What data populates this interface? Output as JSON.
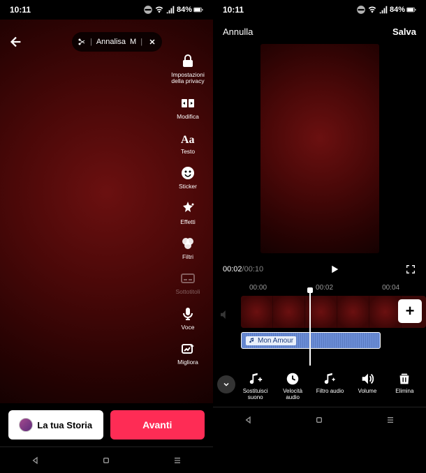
{
  "status": {
    "time": "10:11",
    "battery": "84%"
  },
  "left": {
    "music_pill": {
      "artist": "Annalisa",
      "track_partial": "M",
      "scissor": "scissor-icon"
    },
    "tools": [
      {
        "id": "privacy",
        "label": "Impostazioni della privacy",
        "icon": "lock"
      },
      {
        "id": "modifica",
        "label": "Modifica",
        "icon": "edit"
      },
      {
        "id": "testo",
        "label": "Testo",
        "icon": "text"
      },
      {
        "id": "sticker",
        "label": "Sticker",
        "icon": "sticker"
      },
      {
        "id": "effetti",
        "label": "Effetti",
        "icon": "effects"
      },
      {
        "id": "filtri",
        "label": "Filtri",
        "icon": "filters"
      },
      {
        "id": "sottotitoli",
        "label": "Sottotitoli",
        "icon": "cc",
        "dim": true
      },
      {
        "id": "voce",
        "label": "Voce",
        "icon": "mic"
      },
      {
        "id": "migliora",
        "label": "Migliora",
        "icon": "enhance"
      }
    ],
    "story_button": "La tua Storia",
    "next_button": "Avanti"
  },
  "right": {
    "cancel": "Annulla",
    "save": "Salva",
    "time": {
      "current": "00:02",
      "total": "00:10"
    },
    "ruler": [
      "00:00",
      "00:02",
      "00:04"
    ],
    "audio_track": {
      "title": "Mon Amour",
      "icon": "music-note"
    },
    "tools": [
      {
        "id": "sostituisci",
        "label": "Sostituisci suono",
        "icon": "sound-replace"
      },
      {
        "id": "velocita",
        "label": "Velocità audio",
        "icon": "speed"
      },
      {
        "id": "filtro",
        "label": "Filtro audio",
        "icon": "audio-filter"
      },
      {
        "id": "volume",
        "label": "Volume",
        "icon": "volume"
      },
      {
        "id": "elimina",
        "label": "Elimina",
        "icon": "trash"
      }
    ]
  }
}
